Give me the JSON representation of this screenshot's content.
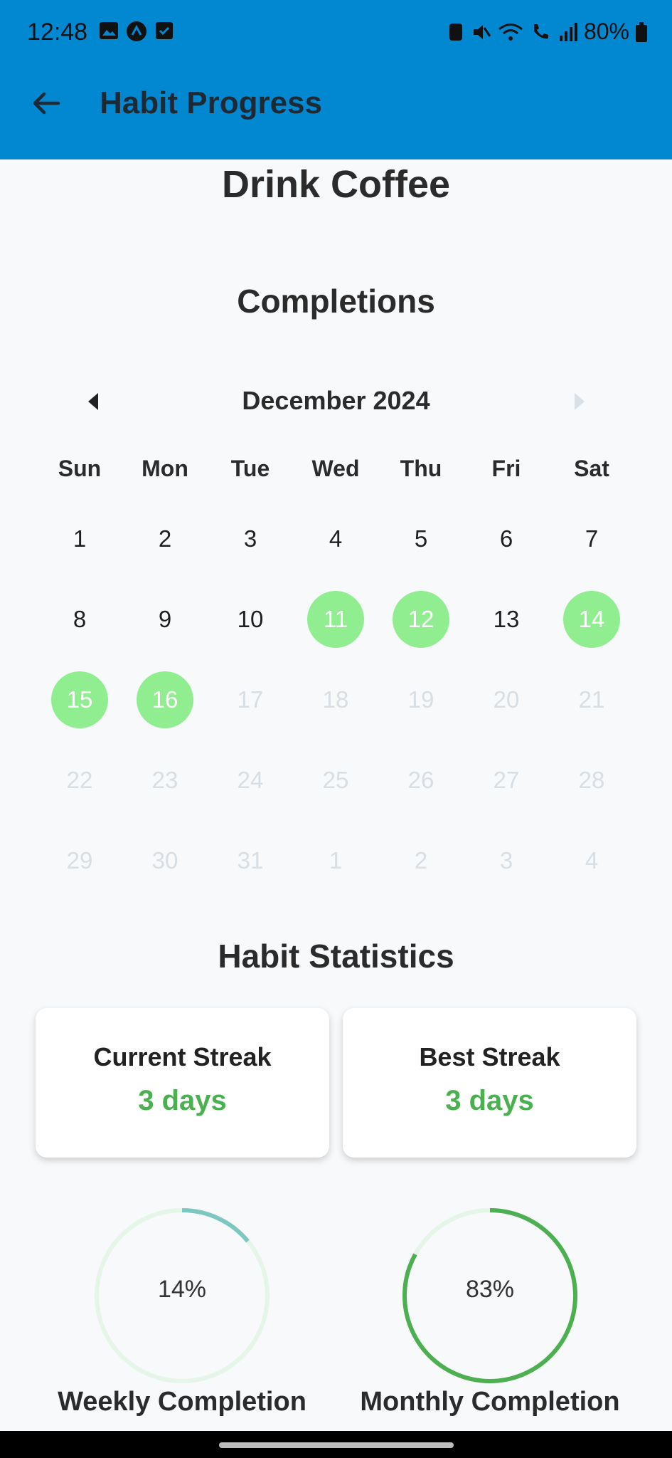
{
  "status_bar": {
    "time": "12:48",
    "battery": "80%"
  },
  "app_bar": {
    "title": "Habit Progress"
  },
  "habit": {
    "name": "Drink Coffee"
  },
  "completions": {
    "title": "Completions",
    "month": "December 2024",
    "weekdays": [
      "Sun",
      "Mon",
      "Tue",
      "Wed",
      "Thu",
      "Fri",
      "Sat"
    ],
    "days": [
      {
        "d": "1",
        "state": "normal"
      },
      {
        "d": "2",
        "state": "normal"
      },
      {
        "d": "3",
        "state": "normal"
      },
      {
        "d": "4",
        "state": "normal"
      },
      {
        "d": "5",
        "state": "normal"
      },
      {
        "d": "6",
        "state": "normal"
      },
      {
        "d": "7",
        "state": "normal"
      },
      {
        "d": "8",
        "state": "normal"
      },
      {
        "d": "9",
        "state": "normal"
      },
      {
        "d": "10",
        "state": "normal"
      },
      {
        "d": "11",
        "state": "done"
      },
      {
        "d": "12",
        "state": "done"
      },
      {
        "d": "13",
        "state": "normal"
      },
      {
        "d": "14",
        "state": "done"
      },
      {
        "d": "15",
        "state": "done"
      },
      {
        "d": "16",
        "state": "done"
      },
      {
        "d": "17",
        "state": "muted"
      },
      {
        "d": "18",
        "state": "muted"
      },
      {
        "d": "19",
        "state": "muted"
      },
      {
        "d": "20",
        "state": "muted"
      },
      {
        "d": "21",
        "state": "muted"
      },
      {
        "d": "22",
        "state": "muted"
      },
      {
        "d": "23",
        "state": "muted"
      },
      {
        "d": "24",
        "state": "muted"
      },
      {
        "d": "25",
        "state": "muted"
      },
      {
        "d": "26",
        "state": "muted"
      },
      {
        "d": "27",
        "state": "muted"
      },
      {
        "d": "28",
        "state": "muted"
      },
      {
        "d": "29",
        "state": "muted"
      },
      {
        "d": "30",
        "state": "muted"
      },
      {
        "d": "31",
        "state": "muted"
      },
      {
        "d": "1",
        "state": "muted"
      },
      {
        "d": "2",
        "state": "muted"
      },
      {
        "d": "3",
        "state": "muted"
      },
      {
        "d": "4",
        "state": "muted"
      }
    ]
  },
  "statistics": {
    "title": "Habit Statistics",
    "current_streak": {
      "label": "Current Streak",
      "value": "3 days"
    },
    "best_streak": {
      "label": "Best Streak",
      "value": "3 days"
    },
    "weekly": {
      "label": "Weekly Completion",
      "text": "14%",
      "fraction": 0.14,
      "color": "#7CC8C0"
    },
    "monthly": {
      "label": "Monthly Completion",
      "text": "83%",
      "fraction": 0.83,
      "color": "#4CAF50"
    }
  },
  "colors": {
    "app_bar": "#0288D1",
    "completed_day": "#90EE90",
    "accent": "#4CAF50"
  }
}
